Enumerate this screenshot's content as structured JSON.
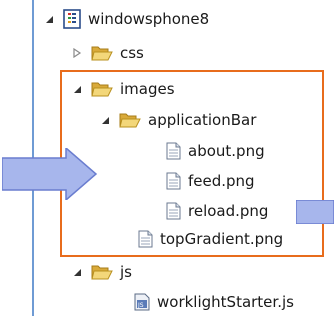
{
  "tree": {
    "project": {
      "label": "windowsphone8",
      "icon": "project-icon"
    },
    "css": {
      "label": "css",
      "icon": "folder-icon"
    },
    "images": {
      "label": "images",
      "icon": "folder-open-icon"
    },
    "applicationBar": {
      "label": "applicationBar",
      "icon": "folder-open-icon"
    },
    "about": {
      "label": "about.png",
      "icon": "file-icon"
    },
    "feed": {
      "label": "feed.png",
      "icon": "file-icon"
    },
    "reload": {
      "label": "reload.png",
      "icon": "file-icon"
    },
    "topGradient": {
      "label": "topGradient.png",
      "icon": "file-icon"
    },
    "js": {
      "label": "js",
      "icon": "folder-open-icon"
    },
    "worklightStarter": {
      "label": "worklightStarter.js",
      "icon": "js-file-icon"
    }
  },
  "colors": {
    "highlight": "#e86c1c",
    "arrow": "#a7b6ec",
    "folder": "#e8c25a",
    "panel_border": "#6f9bd4"
  }
}
